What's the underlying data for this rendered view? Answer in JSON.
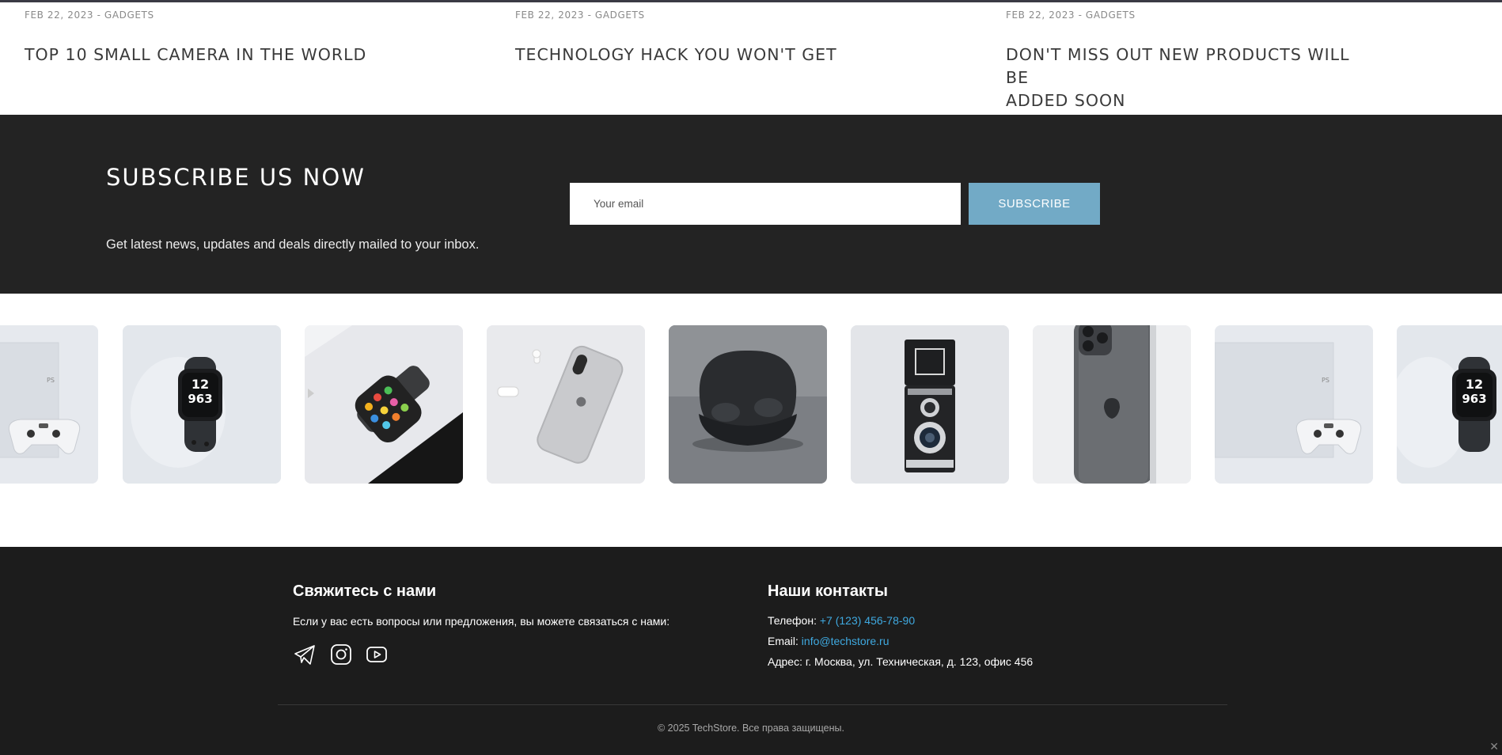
{
  "posts": [
    {
      "meta": "FEB 22, 2023 - GADGETS",
      "title_line1": "TOP 10 SMALL CAMERA IN THE WORLD",
      "title_line2": ""
    },
    {
      "meta": "FEB 22, 2023 - GADGETS",
      "title_line1": "TECHNOLOGY HACK YOU WON'T GET",
      "title_line2": ""
    },
    {
      "meta": "FEB 22, 2023 - GADGETS",
      "title_line1": "DON'T MISS OUT NEW PRODUCTS WILL BE",
      "title_line2": "ADDED SOON"
    }
  ],
  "subscribe": {
    "title": "SUBSCRIBE US NOW",
    "text": "Get latest news, updates and deals directly mailed to your inbox.",
    "placeholder": "Your email",
    "button_label": "SUBSCRIBE"
  },
  "gallery": {
    "items": [
      {
        "icon": "game-console-icon"
      },
      {
        "icon": "smartwatch-icon"
      },
      {
        "icon": "smartwatch-colorful-icon"
      },
      {
        "icon": "smartphone-icon"
      },
      {
        "icon": "earbuds-icon"
      },
      {
        "icon": "camera-icon"
      },
      {
        "icon": "smartphone-back-icon"
      },
      {
        "icon": "game-console-icon"
      },
      {
        "icon": "smartwatch-icon"
      }
    ]
  },
  "footer": {
    "contact_title": "Свяжитесь с нами",
    "contact_text": "Если у вас есть вопросы или предложения, вы можете связаться с нами:",
    "social": [
      "telegram-icon",
      "instagram-icon",
      "youtube-icon"
    ],
    "info_title": "Наши контакты",
    "phone_label": "Телефон:",
    "phone_value": "+7 (123) 456-78-90",
    "email_label": "Email:",
    "email_value": "info@techstore.ru",
    "address": "Адрес: г. Москва, ул. Техническая, д. 123, офис 456",
    "copyright": "© 2025 TechStore. Все права защищены."
  },
  "colors": {
    "dark_band": "#232323",
    "footer_bg": "#1c1c1c",
    "accent_button": "#72aac6",
    "link": "#3fa9e0"
  }
}
